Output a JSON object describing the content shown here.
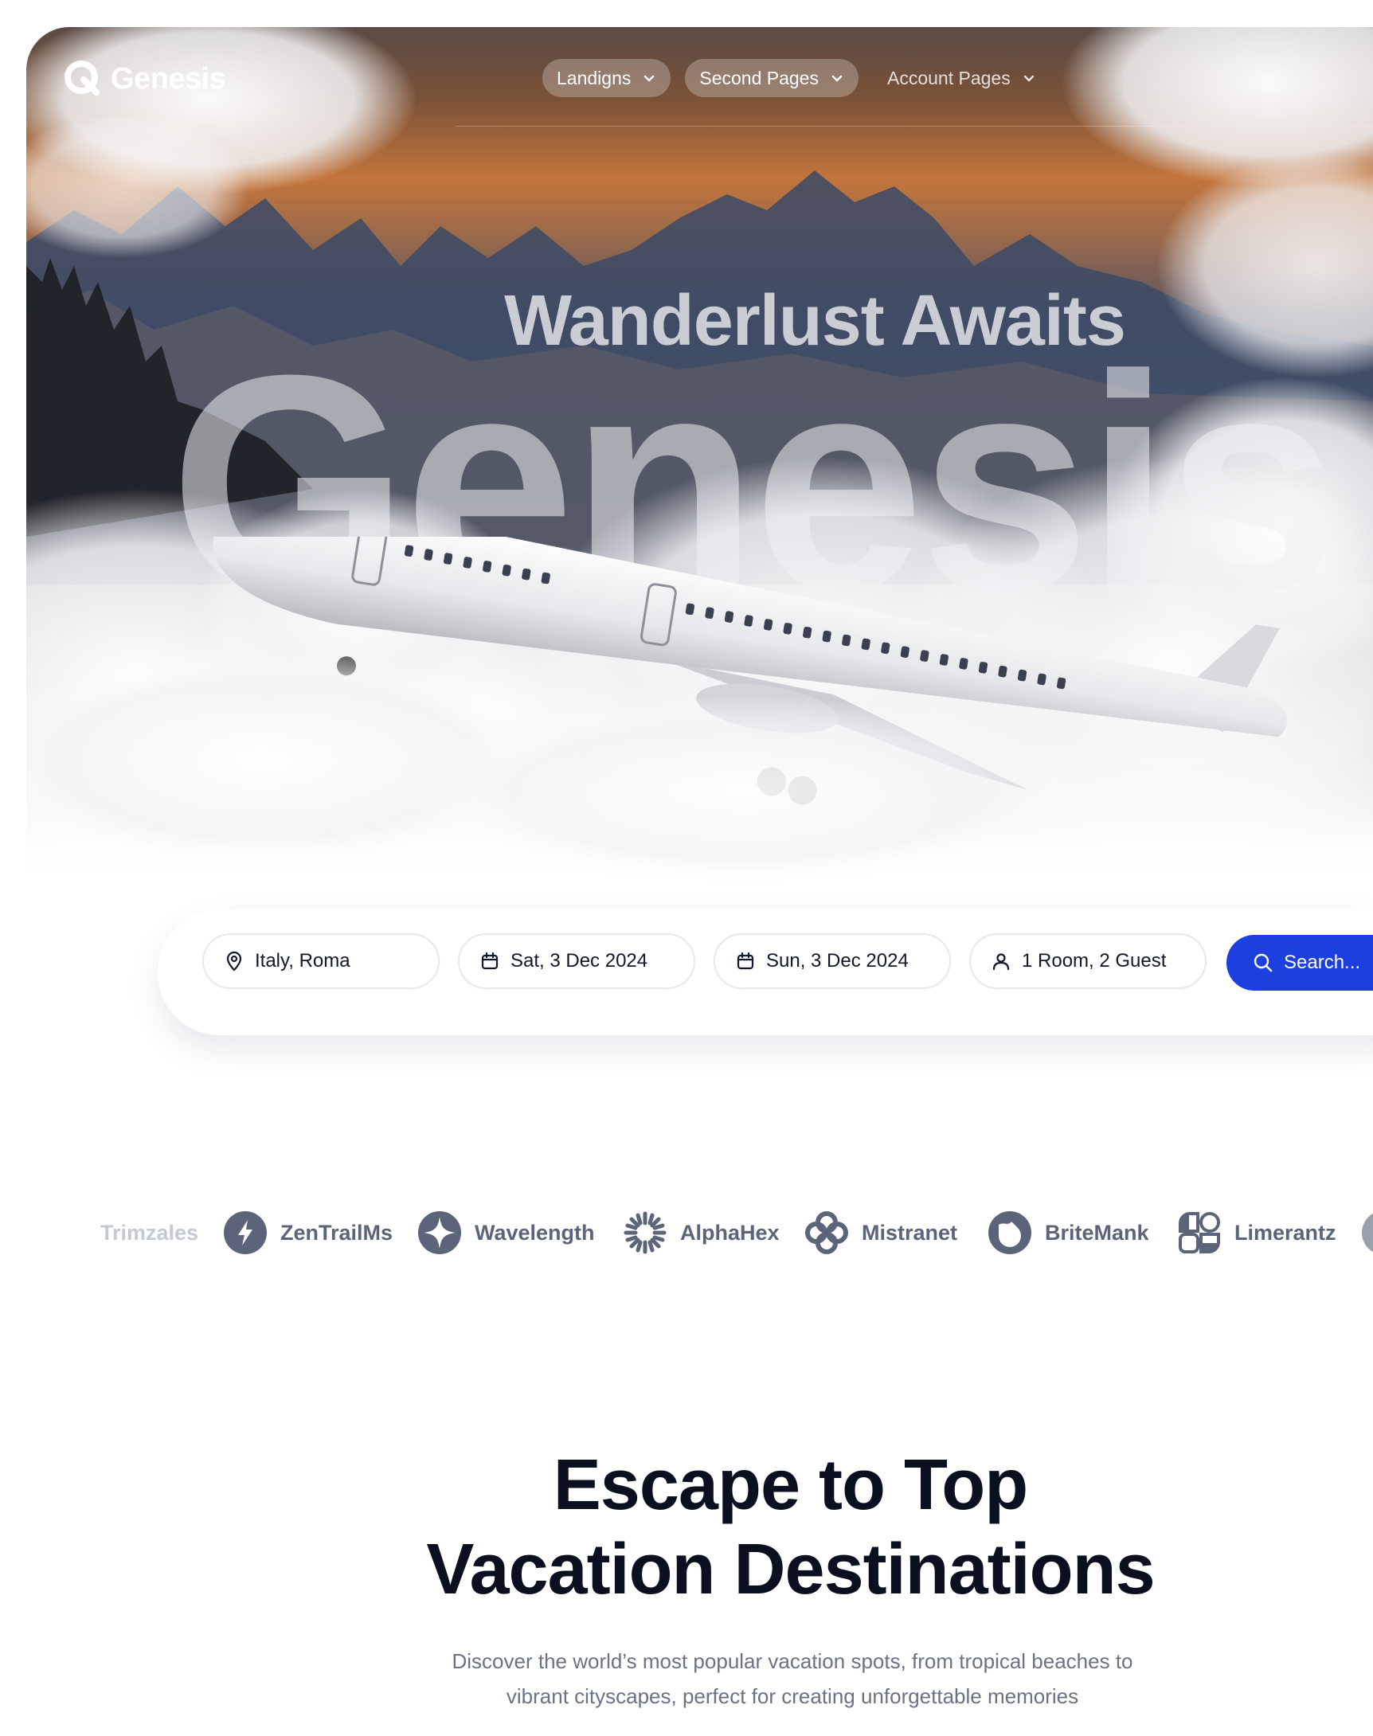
{
  "header": {
    "logo_text": "Genesis",
    "nav": [
      {
        "label": "Landigns",
        "icon": "chevron-down-icon"
      },
      {
        "label": "Second Pages",
        "icon": "chevron-down-icon"
      },
      {
        "label": "Account Pages",
        "icon": "chevron-down-icon"
      }
    ]
  },
  "hero": {
    "title": "Wanderlust Awaits",
    "big_text": "Genesis"
  },
  "search": {
    "location": {
      "value": "Italy, Roma",
      "icon": "map-pin-icon"
    },
    "checkin": {
      "value": "Sat, 3 Dec 2024",
      "icon": "calendar-icon"
    },
    "checkout": {
      "value": "Sun, 3 Dec 2024",
      "icon": "calendar-icon"
    },
    "guests": {
      "value": "1 Room, 2 Guest",
      "icon": "user-icon"
    },
    "button_label": "Search...",
    "button_icon": "search-icon"
  },
  "brands": [
    {
      "name": "Trimzales"
    },
    {
      "name": "ZenTrailMs",
      "icon": "lightning-icon"
    },
    {
      "name": "Wavelength",
      "icon": "four-point-star-icon"
    },
    {
      "name": "AlphaHex",
      "icon": "sunburst-icon"
    },
    {
      "name": "Mistranet",
      "icon": "flower-icon"
    },
    {
      "name": "BriteMank",
      "icon": "drop-icon"
    },
    {
      "name": "Limerantz",
      "icon": "quad-shapes-icon"
    }
  ],
  "section": {
    "title_line1": "Escape to Top",
    "title_line2": "Vacation Destinations",
    "subtitle_line1": "Discover the world’s most popular vacation spots, from tropical beaches to",
    "subtitle_line2": "vibrant cityscapes, perfect for creating unforgettable memories"
  },
  "colors": {
    "primary_button": "#1c3fe0",
    "heading": "#0b1020",
    "muted_text": "#6b7280",
    "brand_gray": "#5b6478"
  }
}
